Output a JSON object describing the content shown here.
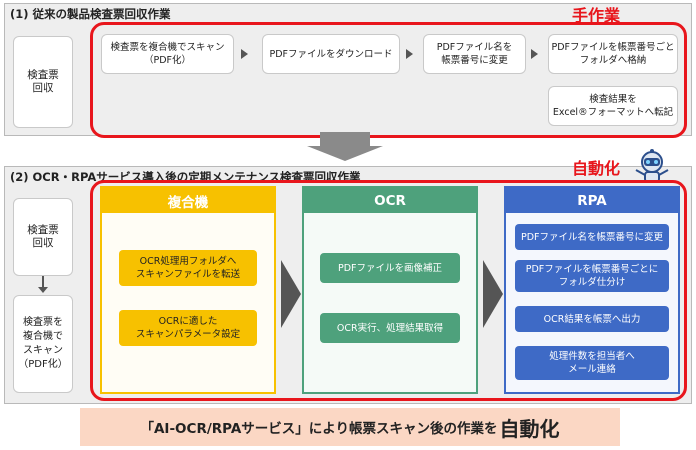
{
  "colors": {
    "red": "#e8161c",
    "yellow": "#f7c100",
    "green": "#4ea17c",
    "blue": "#3e6ac6",
    "arrow_gray": "#555555"
  },
  "section1": {
    "title": "(1) 従来の製品検査票回収作業",
    "tag": "手作業",
    "left_box": "検査票\n回収",
    "steps": [
      "検査票を複合機でスキャン\n（PDF化）",
      "PDFファイルをダウンロード",
      "PDFファイル名を\n帳票番号に変更",
      "PDFファイルを帳票番号ごと\nフォルダへ格納"
    ],
    "extra_step": "検査結果を\nExcel®フォーマットへ転記"
  },
  "section2": {
    "title": "(2) OCR・RPAサービス導入後の定期メンテナンス検査票回収作業",
    "tag": "自動化",
    "robot_icon": "robot-icon",
    "left_boxes": [
      "検査票\n回収",
      "検査票を\n複合機で\nスキャン\n（PDF化）"
    ],
    "columns": [
      {
        "name": "複合機",
        "color": "#f7c100",
        "items": [
          "OCR処理用フォルダへ\nスキャンファイルを転送",
          "OCRに適した\nスキャンパラメータ設定"
        ]
      },
      {
        "name": "OCR",
        "color": "#4ea17c",
        "items": [
          "PDFファイルを画像補正",
          "OCR実行、処理結果取得"
        ]
      },
      {
        "name": "RPA",
        "color": "#3e6ac6",
        "items": [
          "PDFファイル名を帳票番号に変更",
          "PDFファイルを帳票番号ごとに\nフォルダ仕分け",
          "OCR結果を帳票へ出力",
          "処理件数を担当者へ\nメール連絡"
        ]
      }
    ]
  },
  "banner": {
    "part1": "「AI-OCR/RPAサービス」により帳票スキャン後の作業を",
    "part2": "自動化"
  }
}
